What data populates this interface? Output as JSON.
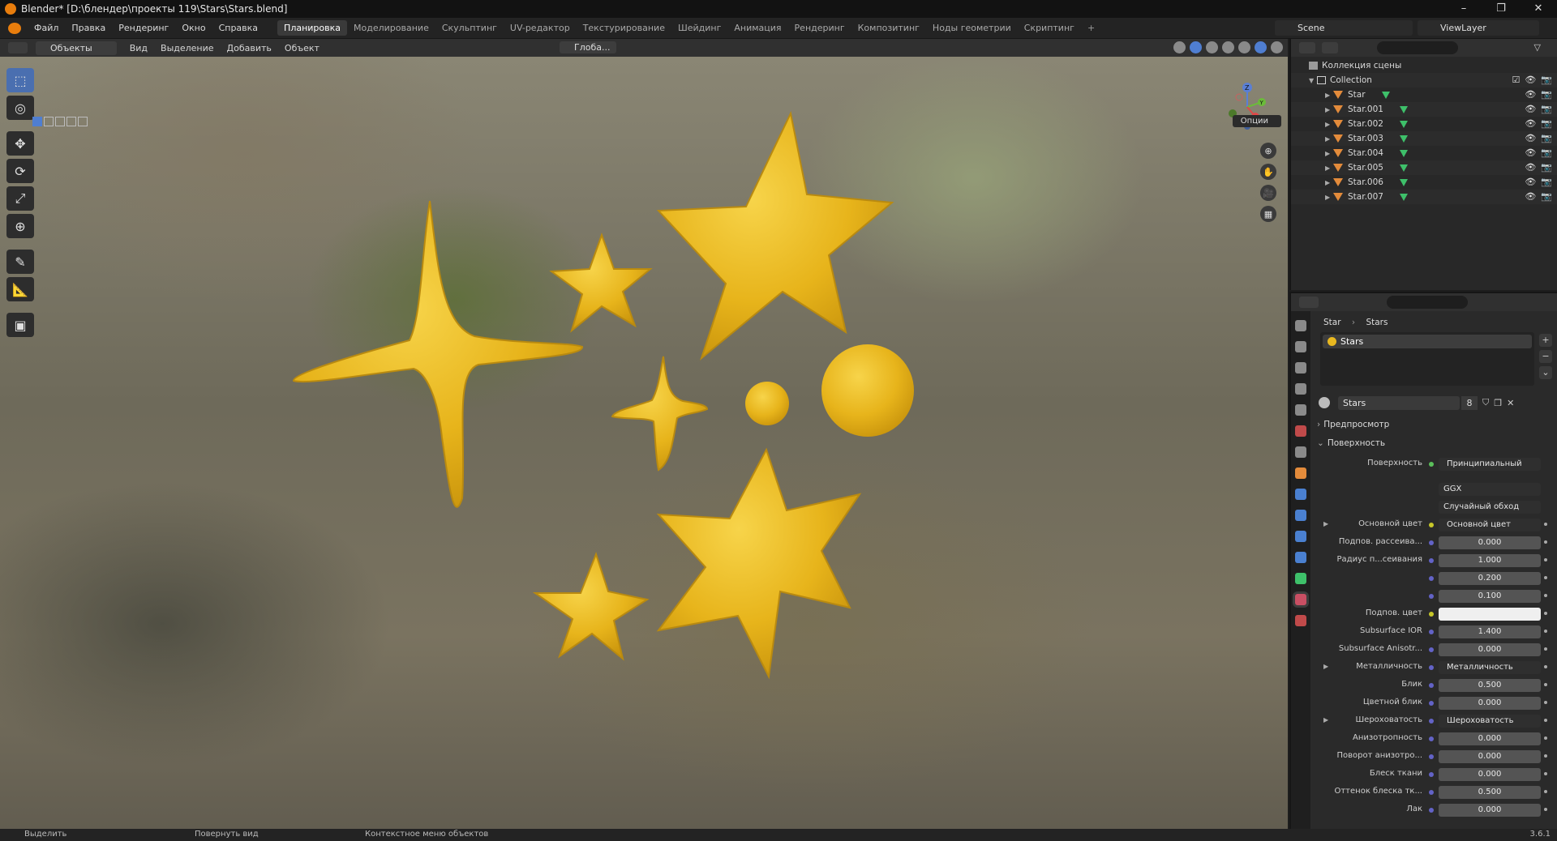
{
  "window": {
    "title": "Blender* [D:\\блендер\\проекты 119\\Stars\\Stars.blend]",
    "controls": [
      "–",
      "❐",
      "✕"
    ]
  },
  "menu": [
    "Файл",
    "Правка",
    "Рендеринг",
    "Окно",
    "Справка"
  ],
  "workspaces": [
    "Планировка",
    "Моделирование",
    "Скульптинг",
    "UV-редактор",
    "Текстурирование",
    "Шейдинг",
    "Анимация",
    "Рендеринг",
    "Композитинг",
    "Ноды геометрии",
    "Скриптинг"
  ],
  "workspace_active": "Планировка",
  "scene": "Scene",
  "view_layer": "ViewLayer",
  "viewport": {
    "mode": "Объекты",
    "menus": [
      "Вид",
      "Выделение",
      "Добавить",
      "Объект"
    ],
    "pivot": "Глоба...",
    "options": "Опции",
    "gizmo_axes": [
      "Z",
      "Y",
      "X"
    ]
  },
  "outliner": {
    "scene_collection": "Коллекция сцены",
    "collection": "Collection",
    "objects": [
      "Star",
      "Star.001",
      "Star.002",
      "Star.003",
      "Star.004",
      "Star.005",
      "Star.006",
      "Star.007"
    ]
  },
  "properties": {
    "breadcrumb_object": "Star",
    "breadcrumb_material": "Stars",
    "slot": "Stars",
    "material_name": "Stars",
    "users": "8",
    "panel_preview": "Предпросмотр",
    "panel_surface": "Поверхность",
    "surface_label": "Поверхность",
    "surface_value": "Принципиальный BSDF",
    "distribution": "GGX",
    "subsurface_method": "Случайный обход",
    "rows": [
      {
        "label": "Основной цвет",
        "value": "Основной цвет",
        "kind": "link",
        "expand": true
      },
      {
        "label": "Подпов. рассеива...",
        "value": "0.000",
        "kind": "num"
      },
      {
        "label": "Радиус п...сеивания",
        "value": "1.000",
        "kind": "num"
      },
      {
        "label": "",
        "value": "0.200",
        "kind": "num"
      },
      {
        "label": "",
        "value": "0.100",
        "kind": "num"
      },
      {
        "label": "Подпов. цвет",
        "value": "",
        "kind": "color"
      },
      {
        "label": "Subsurface IOR",
        "value": "1.400",
        "kind": "num",
        "fill": 0.1
      },
      {
        "label": "Subsurface Anisotr...",
        "value": "0.000",
        "kind": "num"
      },
      {
        "label": "Металличность",
        "value": "Металличность",
        "kind": "link",
        "expand": true
      },
      {
        "label": "Блик",
        "value": "0.500",
        "kind": "num",
        "fill": 0.5
      },
      {
        "label": "Цветной блик",
        "value": "0.000",
        "kind": "num"
      },
      {
        "label": "Шероховатость",
        "value": "Шероховатость",
        "kind": "link",
        "expand": true
      },
      {
        "label": "Анизотропность",
        "value": "0.000",
        "kind": "num"
      },
      {
        "label": "Поворот анизотро...",
        "value": "0.000",
        "kind": "num"
      },
      {
        "label": "Блеск ткани",
        "value": "0.000",
        "kind": "num"
      },
      {
        "label": "Оттенок блеска тк...",
        "value": "0.500",
        "kind": "num",
        "fill": 0.5
      },
      {
        "label": "Лак",
        "value": "0.000",
        "kind": "num"
      }
    ]
  },
  "status": {
    "select": "Выделить",
    "rotate": "Повернуть вид",
    "context": "Контекстное меню объектов",
    "version": "3.6.1"
  },
  "colors": {
    "accent": "#4772b3",
    "star": "#e8b41c",
    "object_icon": "#e38b3b",
    "mesh_icon": "#3ec06a"
  }
}
